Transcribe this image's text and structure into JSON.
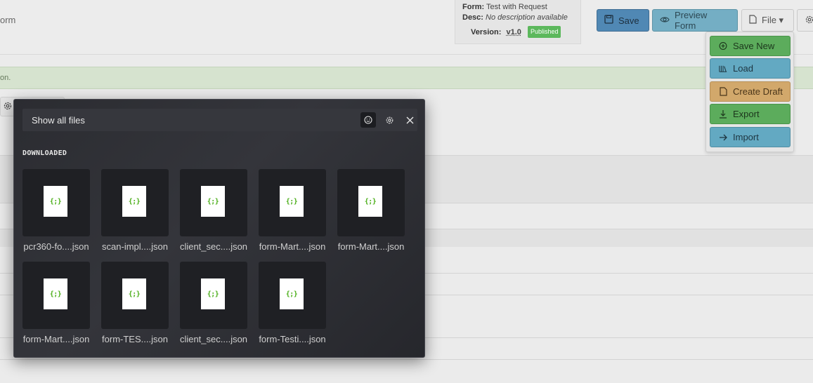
{
  "page": {
    "crumb": "orm",
    "meta": {
      "form_key": "Form:",
      "form_val": "Test with Request",
      "desc_key": "Desc:",
      "desc_val": "No description available",
      "version_key": "Version:",
      "version_val": "v1.0",
      "status_badge": "Published"
    },
    "toolbar": {
      "save_label": "Save",
      "preview_label": "Preview Form",
      "file_label": "File ▾"
    },
    "notice_text": "on."
  },
  "file_menu": {
    "items": [
      {
        "label": "Save New",
        "icon": "plus-circle-icon"
      },
      {
        "label": "Load",
        "icon": "library-icon"
      },
      {
        "label": "Create Draft",
        "icon": "document-icon"
      },
      {
        "label": "Export",
        "icon": "download-icon"
      },
      {
        "label": "Import",
        "icon": "arrow-right-icon"
      }
    ]
  },
  "file_picker": {
    "header_title": "Show all files",
    "section_title": "DOWNLOADED",
    "thumb_text": "{;}",
    "files": [
      "pcr360-fo....json",
      "scan-impl....json",
      "client_sec....json",
      "form-Mart....json",
      "form-Mart....json",
      "form-Mart....json",
      "form-TES....json",
      "client_sec....json",
      "form-Testi....json"
    ]
  },
  "colors": {
    "modal_bg": "#2b2c31",
    "json_icon_green": "#4caf1a",
    "save_blue": "#5088b4",
    "success_green": "#5cac5c"
  }
}
